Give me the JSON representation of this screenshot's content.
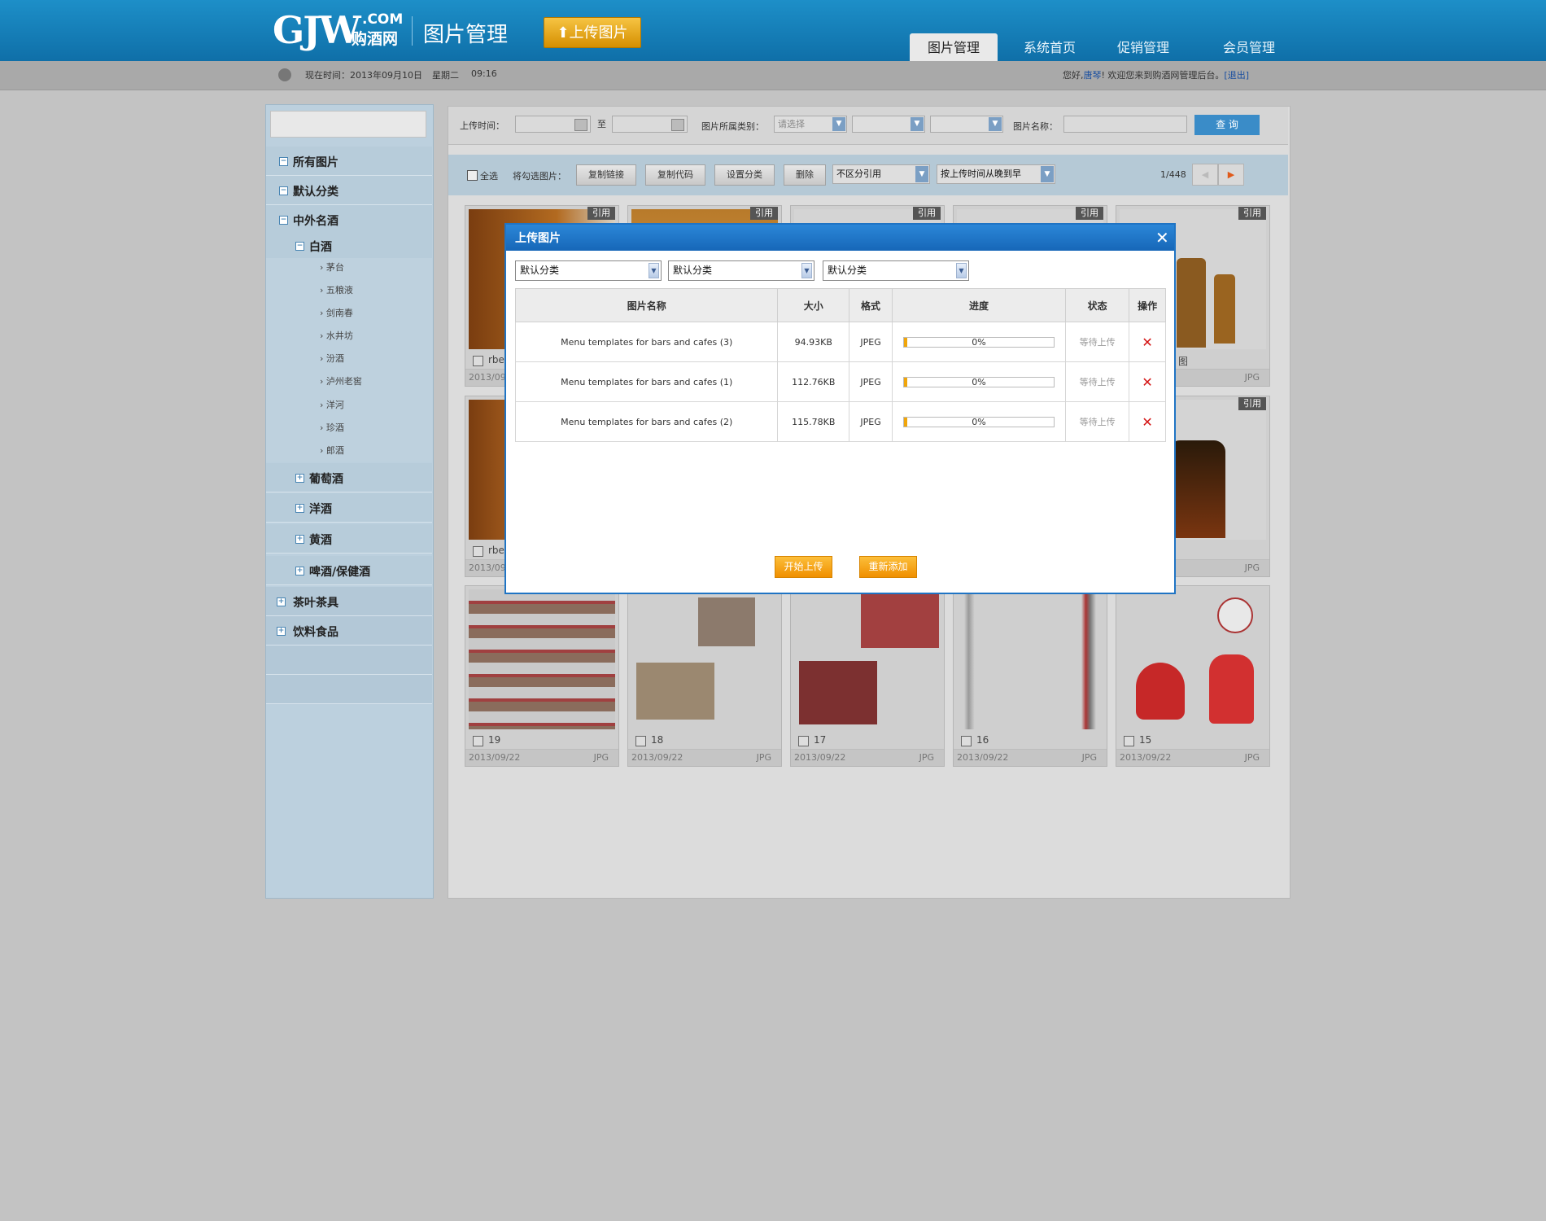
{
  "header": {
    "logo_main": "GJW",
    "logo_com": ".COM",
    "logo_cn": "购酒网",
    "title": "图片管理",
    "upload_button": "上传图片",
    "nav": [
      "图片管理",
      "系统首页",
      "促销管理",
      "会员管理"
    ]
  },
  "subbar": {
    "time_label": "现在时间：2013年09月10日",
    "weekday": "星期二",
    "clock": "09:16",
    "greeting_prefix": "您好,",
    "user": "唐琴",
    "greeting_suffix": "! 欢迎您来到购酒网管理后台。",
    "logout": "[退出]"
  },
  "sidebar": {
    "items": [
      "所有图片",
      "默认分类",
      "中外名酒"
    ],
    "sub_open": "白酒",
    "leaves": [
      "茅台",
      "五粮液",
      "剑南春",
      "水井坊",
      "汾酒",
      "泸州老窖",
      "洋河",
      "珍酒",
      "郎酒"
    ],
    "subs": [
      "葡萄酒",
      "洋酒",
      "黄酒",
      "啤酒/保健酒"
    ],
    "bottom": [
      "茶叶茶具",
      "饮料食品"
    ]
  },
  "search": {
    "upload_time_label": "上传时间：",
    "to": "至",
    "category_label": "图片所属类别：",
    "category_placeholder": "请选择",
    "name_label": "图片名称：",
    "query_button": "查 询"
  },
  "toolbar": {
    "select_all": "全选",
    "selected_label": "将勾选图片：",
    "copy_link": "复制链接",
    "copy_code": "复制代码",
    "set_category": "设置分类",
    "delete": "删除",
    "ref_filter": "不区分引用",
    "sort": "按上传时间从晚到早",
    "page": "1/448"
  },
  "grid": {
    "badge": "引用",
    "rows": [
      [
        {
          "num": "rbe",
          "date": "2013/09",
          "type": ""
        },
        {
          "num": "",
          "date": "",
          "type": ""
        },
        {
          "num": "",
          "date": "",
          "type": ""
        },
        {
          "num": "",
          "date": "",
          "type": ""
        },
        {
          "num": "图",
          "date": "",
          "type": "JPG"
        }
      ],
      [
        {
          "num": "rbe",
          "date": "2013/09",
          "type": ""
        },
        {
          "num": "",
          "date": "",
          "type": ""
        },
        {
          "num": "",
          "date": "",
          "type": ""
        },
        {
          "num": "",
          "date": "",
          "type": ""
        },
        {
          "num": "",
          "date": "",
          "type": "JPG"
        }
      ],
      [
        {
          "num": "19",
          "date": "2013/09/22",
          "type": "JPG"
        },
        {
          "num": "18",
          "date": "2013/09/22",
          "type": "JPG"
        },
        {
          "num": "17",
          "date": "2013/09/22",
          "type": "JPG"
        },
        {
          "num": "16",
          "date": "2013/09/22",
          "type": "JPG"
        },
        {
          "num": "15",
          "date": "2013/09/22",
          "type": "JPG"
        }
      ]
    ]
  },
  "modal": {
    "title": "上传图片",
    "selects": [
      "默认分类",
      "默认分类",
      "默认分类"
    ],
    "columns": [
      "图片名称",
      "大小",
      "格式",
      "进度",
      "状态",
      "操作"
    ],
    "files": [
      {
        "name": "Menu templates for bars and cafes (3)",
        "size": "94.93KB",
        "format": "JPEG",
        "progress": "0%",
        "progress_value": 0.02,
        "status": "等待上传"
      },
      {
        "name": "Menu templates for bars and cafes (1)",
        "size": "112.76KB",
        "format": "JPEG",
        "progress": "0%",
        "progress_value": 0.02,
        "status": "等待上传"
      },
      {
        "name": "Menu templates for bars and cafes (2)",
        "size": "115.78KB",
        "format": "JPEG",
        "progress": "0%",
        "progress_value": 0.02,
        "status": "等待上传"
      }
    ],
    "start_button": "开始上传",
    "re_add_button": "重新添加"
  },
  "colors": {
    "header_blue": "#1584bf",
    "modal_blue": "#1f74c4",
    "orange": "#f5a30c",
    "delete_red": "#d41515"
  }
}
